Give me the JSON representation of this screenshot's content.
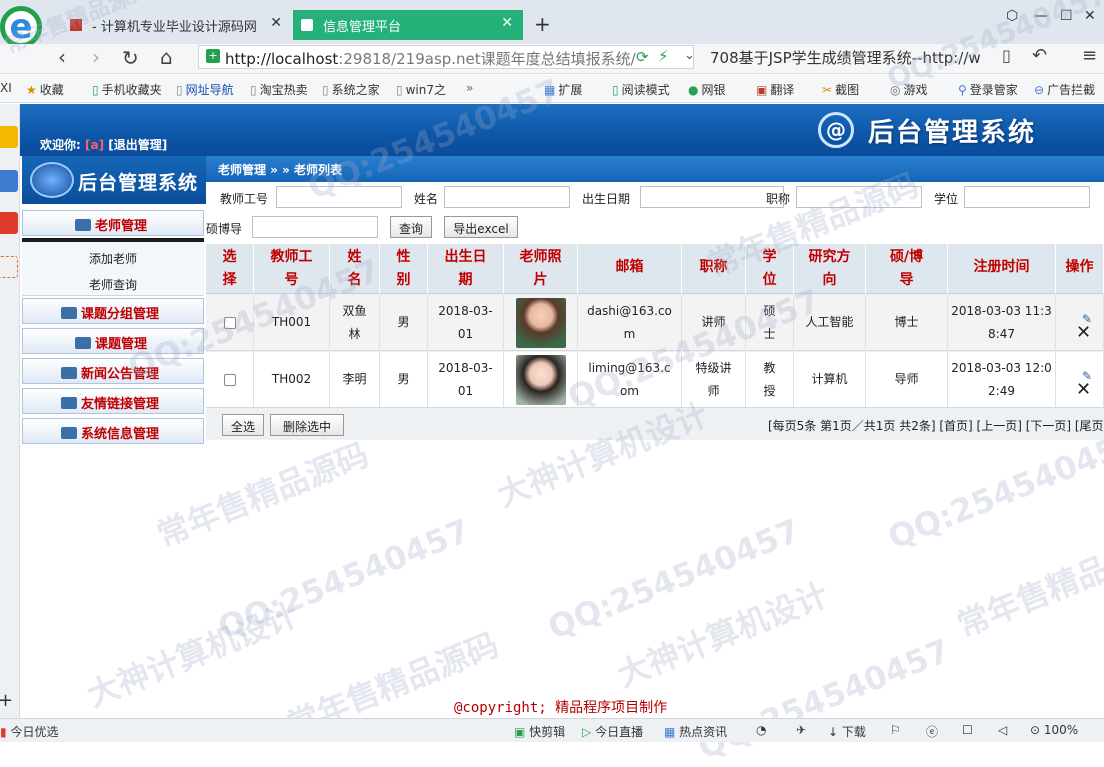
{
  "browser": {
    "tabs": [
      {
        "title": "- 计算机专业毕业设计源码网"
      },
      {
        "title": "信息管理平台"
      }
    ],
    "url_host": "http://localhost",
    "url_rest": ":29818/219asp.net课题年度总结填报系统/",
    "search_text": "708基于JSP学生成绩管理系统--http://w",
    "bookmarks": [
      "收藏",
      "手机收藏夹",
      "网址导航",
      "淘宝热卖",
      "系统之家",
      "win7之"
    ],
    "bm_right": [
      "扩展",
      "阅读模式",
      "网银",
      "翻译",
      "截图",
      "游戏",
      "登录管家",
      "广告拦截"
    ],
    "left_partial": "XI"
  },
  "header": {
    "welcome_label": "欢迎你:",
    "user": "[a]",
    "logout": "[退出管理]",
    "title": "后台管理系统"
  },
  "menu": {
    "title": "后台管理系统",
    "groups": [
      {
        "label": "老师管理",
        "items": [
          "添加老师",
          "老师查询"
        ]
      },
      {
        "label": "课题分组管理"
      },
      {
        "label": "课题管理"
      },
      {
        "label": "新闻公告管理"
      },
      {
        "label": "友情链接管理"
      },
      {
        "label": "系统信息管理"
      }
    ]
  },
  "breadcrumb": "老师管理 » » 老师列表",
  "filters": {
    "labels": [
      "教师工号",
      "姓名",
      "出生日期",
      "职称",
      "学位",
      "硕博导"
    ],
    "query_button": "查询",
    "export_button": "导出excel"
  },
  "table": {
    "headers": [
      "选择",
      "教师工号",
      "姓名",
      "性别",
      "出生日期",
      "老师照片",
      "邮箱",
      "职称",
      "学位",
      "研究方向",
      "硕/博导",
      "注册时间",
      "操作"
    ],
    "header_lines": [
      [
        "选",
        "择"
      ],
      [
        "教师工",
        "号"
      ],
      [
        "姓",
        "名"
      ],
      [
        "性",
        "别"
      ],
      [
        "出生日",
        "期"
      ],
      [
        "老师照",
        "片"
      ],
      [
        "邮箱"
      ],
      [
        "职称"
      ],
      [
        "学",
        "位"
      ],
      [
        "研究方",
        "向"
      ],
      [
        "硕/博",
        "导"
      ],
      [
        "注册时间"
      ],
      [
        "操作"
      ]
    ],
    "rows": [
      {
        "id": "TH001",
        "name": [
          "双鱼",
          "林"
        ],
        "gender": "男",
        "birth": [
          "2018-03-",
          "01"
        ],
        "email": [
          "dashi@163.co",
          "m"
        ],
        "title": "讲师",
        "degree": [
          "硕",
          "士"
        ],
        "research": "人工智能",
        "advisor": "博士",
        "reg": [
          "2018-03-03 11:3",
          "8:47"
        ]
      },
      {
        "id": "TH002",
        "name": [
          "李明"
        ],
        "gender": "男",
        "birth": [
          "2018-03-",
          "01"
        ],
        "email": [
          "liming@163.c",
          "om"
        ],
        "title": [
          "特级讲",
          "师"
        ],
        "degree": [
          "教",
          "授"
        ],
        "research": "计算机",
        "advisor": "导师",
        "reg": [
          "2018-03-03 12:0",
          "2:49"
        ]
      }
    ],
    "select_all": "全选",
    "delete_selected": "删除选中",
    "pager": "[每页5条 第1页／共1页 共2条] [首页] [上一页] [下一页] [尾页]"
  },
  "copyright": "@copyright; 精品程序项目制作",
  "statusbar": {
    "left": "今日优选",
    "items": [
      "快剪辑",
      "今日直播",
      "热点资讯",
      "下载",
      "100%"
    ]
  },
  "watermark": [
    "常年售精品源码",
    "QQ:254540457",
    "大神计算机设计"
  ],
  "colors": {
    "header_blue": "#0d56a8",
    "tab_active": "#24b27a",
    "header_text": "#c00000"
  }
}
